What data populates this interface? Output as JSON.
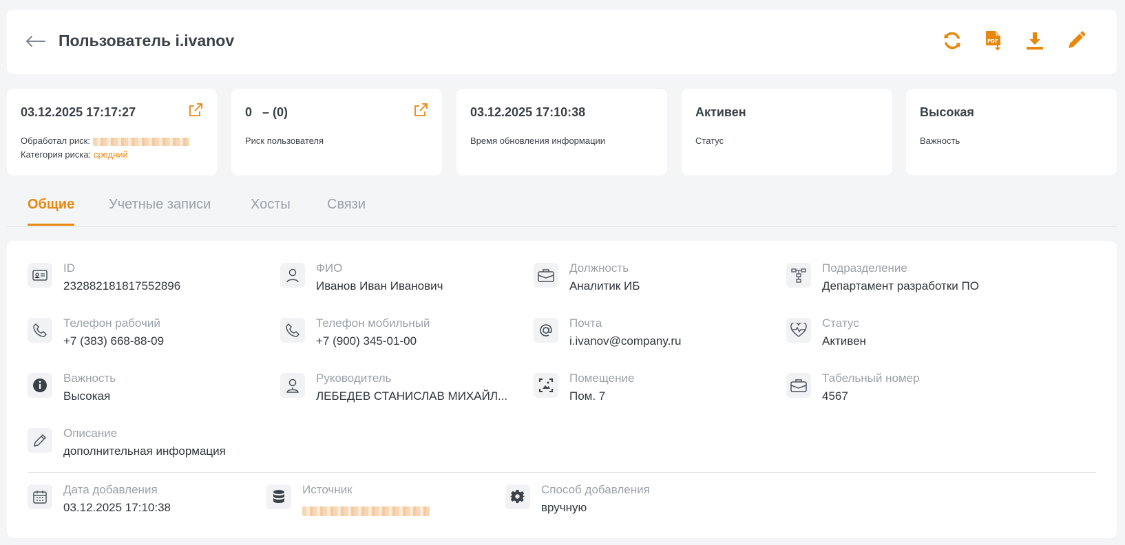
{
  "header": {
    "title": "Пользователь i.ivanov",
    "actions": [
      "refresh-icon",
      "pdf-export-icon",
      "download-icon",
      "edit-icon"
    ]
  },
  "cards": [
    {
      "value": "03.12.2025 17:17:27",
      "label_processed": "Обработал риск:",
      "label_category": "Категория риска:",
      "category_value": "средний",
      "has_link": true
    },
    {
      "value": "0   – (0)",
      "label": "Риск пользователя",
      "has_link": true
    },
    {
      "value": "03.12.2025 17:10:38",
      "label": "Время обновления информации"
    },
    {
      "value": "Активен",
      "label": "Статус"
    },
    {
      "value": "Высокая",
      "label": "Важность"
    }
  ],
  "tabs": [
    {
      "label": "Общие",
      "active": true
    },
    {
      "label": "Учетные записи"
    },
    {
      "label": "Хосты"
    },
    {
      "label": "Связи"
    }
  ],
  "fields": {
    "id": {
      "label": "ID",
      "value": "232882181817552896",
      "icon": "id-card-icon"
    },
    "fio": {
      "label": "ФИО",
      "value": "Иванов Иван Иванович",
      "icon": "person-icon"
    },
    "position": {
      "label": "Должность",
      "value": "Аналитик ИБ",
      "icon": "briefcase-icon"
    },
    "department": {
      "label": "Подразделение",
      "value": "Департамент разработки ПО",
      "icon": "org-structure-icon"
    },
    "phone_work": {
      "label": "Телефон рабочий",
      "value": "+7 (383) 668-88-09",
      "icon": "phone-icon"
    },
    "phone_mobile": {
      "label": "Телефон мобильный",
      "value": "+7 (900) 345-01-00",
      "icon": "phone-icon"
    },
    "email": {
      "label": "Почта",
      "value": "i.ivanov@company.ru",
      "icon": "at-icon"
    },
    "status": {
      "label": "Статус",
      "value": "Активен",
      "icon": "heart-pulse-icon"
    },
    "importance": {
      "label": "Важность",
      "value": "Высокая",
      "icon": "info-icon"
    },
    "manager": {
      "label": "Руководитель",
      "value": "ЛЕБЕДЕВ СТАНИСЛАВ МИХАЙЛ...",
      "icon": "person-badge-icon"
    },
    "room": {
      "label": "Помещение",
      "value": "Пом. 7",
      "icon": "room-icon"
    },
    "tab_number": {
      "label": "Табельный номер",
      "value": "4567",
      "icon": "briefcase-icon"
    },
    "description": {
      "label": "Описание",
      "value": "дополнительная информация",
      "icon": "pencil-icon"
    },
    "date_added": {
      "label": "Дата добавления",
      "value": "03.12.2025 17:10:38",
      "icon": "calendar-icon"
    },
    "source": {
      "label": "Источник",
      "icon": "database-icon"
    },
    "add_method": {
      "label": "Способ добавления",
      "value": "вручную",
      "icon": "gear-icon"
    }
  },
  "colors": {
    "accent": "#e8870f",
    "background": "#f4f5f7",
    "text": "#333a40",
    "muted": "#9aa1a8"
  }
}
